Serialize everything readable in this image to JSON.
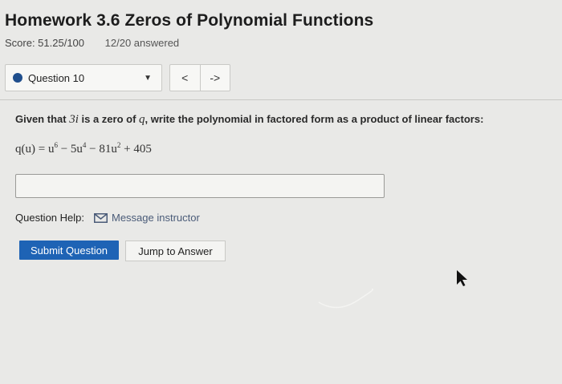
{
  "header": {
    "title": "Homework 3.6 Zeros of Polynomial Functions",
    "score": "Score: 51.25/100",
    "answered": "12/20 answered"
  },
  "question_nav": {
    "selected": "Question 10",
    "caret": "▼",
    "prev": "<",
    "next": "->"
  },
  "question": {
    "prompt_before": "Given that",
    "zero": "3i",
    "prompt_middle": "is a zero of",
    "function_name": "q",
    "prompt_after": ", write the polynomial in factored form as a product of linear factors:",
    "equation": {
      "lhs": "q(u) = u",
      "exp1": "6",
      "t2": " − 5u",
      "exp2": "4",
      "t3": " − 81u",
      "exp3": "2",
      "t4": " + 405"
    },
    "answer_value": ""
  },
  "help": {
    "label": "Question Help:",
    "link": "Message instructor"
  },
  "buttons": {
    "submit": "Submit Question",
    "jump": "Jump to Answer"
  },
  "colors": {
    "accent": "#1e63b5",
    "dot": "#1f4e8c",
    "background": "#e9e9e7"
  }
}
